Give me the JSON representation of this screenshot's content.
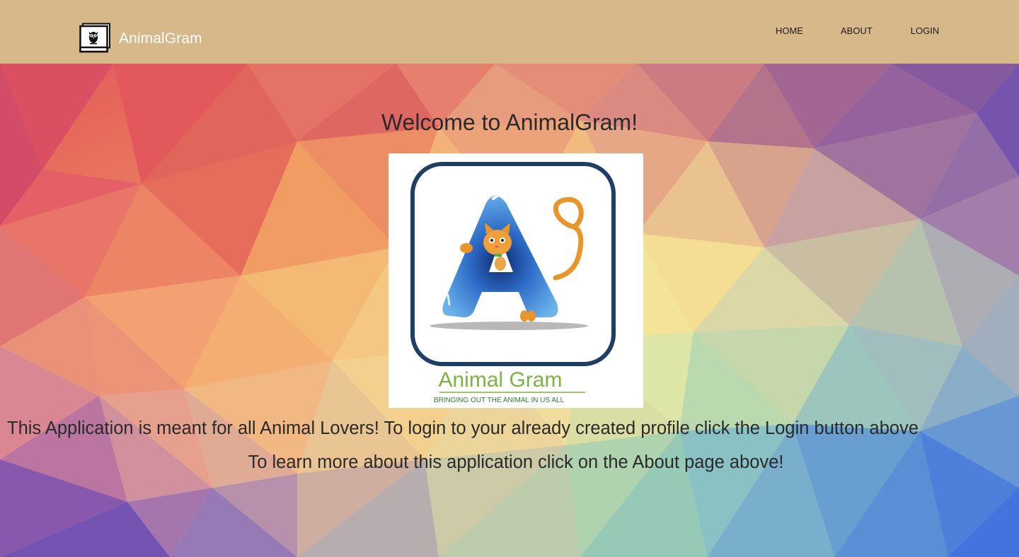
{
  "navbar": {
    "brand_name": "AnimalGram",
    "brand_icon": "owl-photo-frame-icon",
    "background_color": "#d6b88b",
    "links": [
      {
        "label": "HOME"
      },
      {
        "label": "ABOUT"
      },
      {
        "label": "LOGIN"
      }
    ]
  },
  "main": {
    "welcome_title": "Welcome to AnimalGram!",
    "logo": {
      "icon": "animal-gram-letter-a-cat-logo",
      "title": "Animal Gram",
      "tagline": "BRINGING OUT THE ANIMAL IN US ALL"
    },
    "intro_line_1": "This Application is meant for all Animal Lovers! To login to your already created profile click the Login button above",
    "intro_line_2": "To learn more about this application click on the About page above!"
  },
  "colors": {
    "text": "#2a2a2a",
    "logo_green": "#7cb342",
    "logo_navy": "#1f3e66",
    "logo_blue": "#2e7fd0"
  }
}
